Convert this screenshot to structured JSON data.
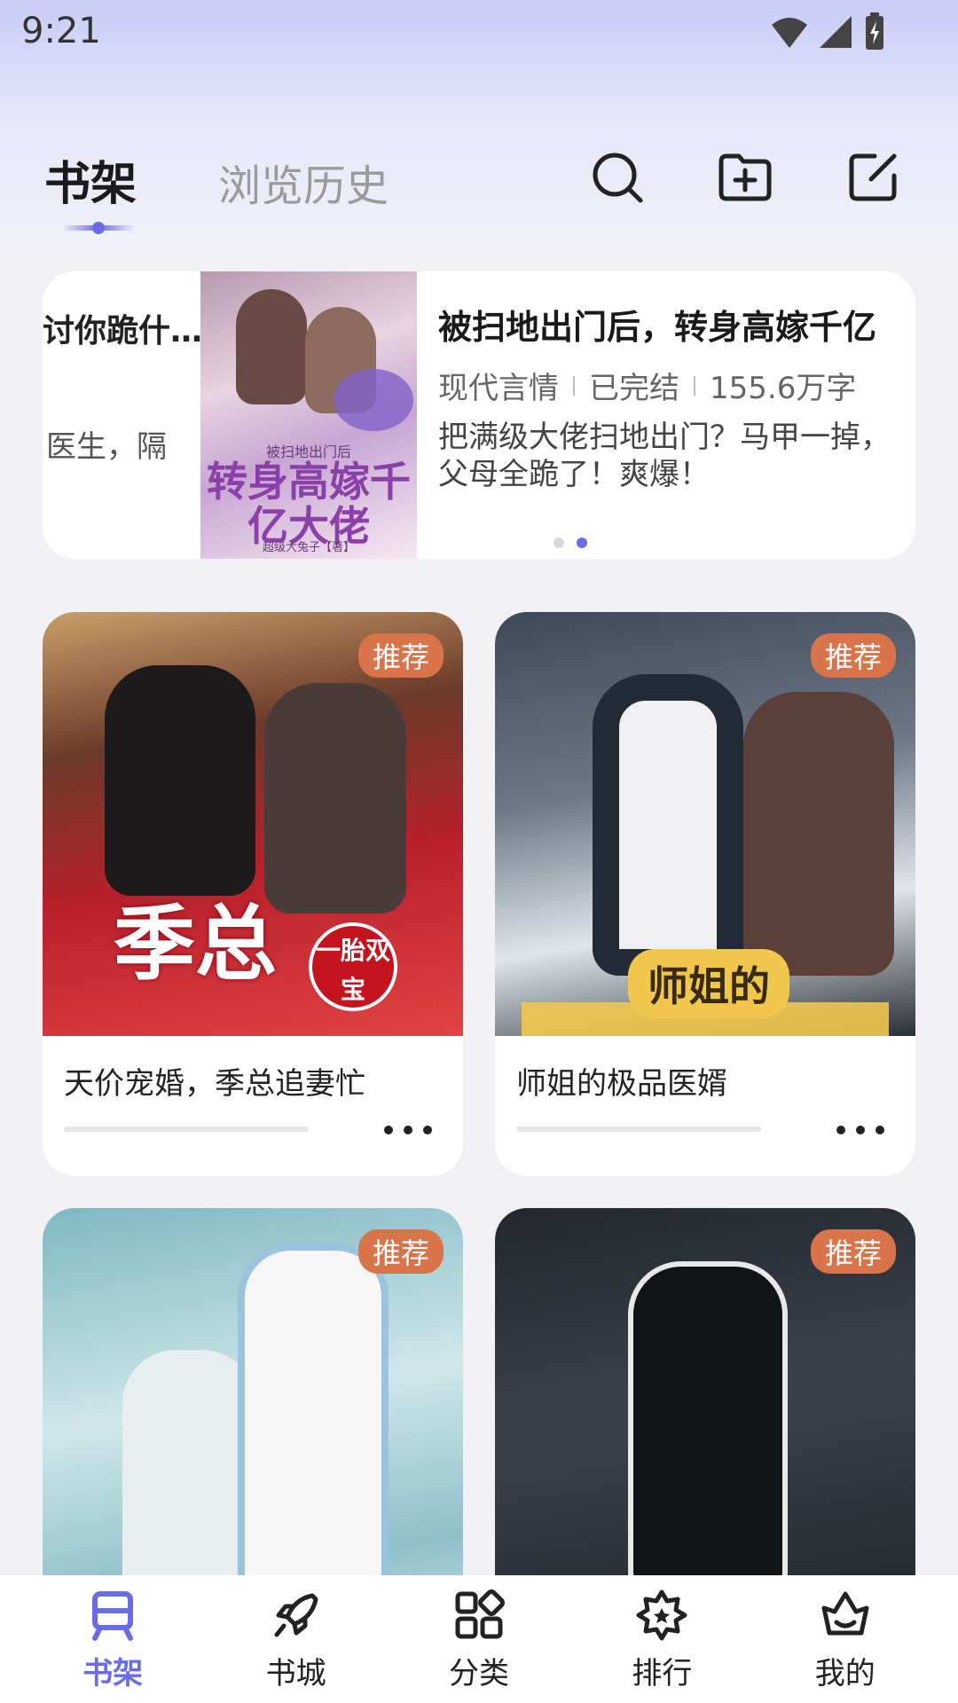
{
  "status_bar": {
    "time": "9:21"
  },
  "header": {
    "tabs": [
      {
        "label": "书架",
        "active": true
      },
      {
        "label": "浏览历史",
        "active": false
      }
    ],
    "icons": [
      "search-icon",
      "add-folder-icon",
      "edit-icon"
    ]
  },
  "banner": {
    "prev_title": "讨你跪什…",
    "prev_desc": "医生，隔",
    "cover": {
      "caption": "被扫地出门后",
      "big_text": "转身高嫁千亿大佬",
      "author": "超级大兔子【著】"
    },
    "title": "被扫地出门后，转身高嫁千亿",
    "meta": [
      "现代言情",
      "已完结",
      "155.6万字"
    ],
    "desc": "把满级大佬扫地出门？马甲一掉，父母全跪了！爽爆！",
    "page_count": 2,
    "active_page": 1
  },
  "books": [
    {
      "title": "天价宠婚，季总追妻忙",
      "badge": "推荐",
      "cover_text": "季总",
      "cover_stamp": "一胎双宝",
      "progress": 0
    },
    {
      "title": "师姐的极品医婿",
      "badge": "推荐",
      "cover_text": "师姐的",
      "progress": 0
    },
    {
      "title": "",
      "badge": "推荐"
    },
    {
      "title": "",
      "badge": "推荐"
    }
  ],
  "bottom_nav": [
    {
      "label": "书架",
      "icon": "bookshelf-icon",
      "active": true
    },
    {
      "label": "书城",
      "icon": "rocket-icon",
      "active": false
    },
    {
      "label": "分类",
      "icon": "category-icon",
      "active": false
    },
    {
      "label": "排行",
      "icon": "ranking-icon",
      "active": false
    },
    {
      "label": "我的",
      "icon": "profile-icon",
      "active": false
    }
  ],
  "colors": {
    "accent": "#6b6be6",
    "badge": "#d9734a"
  }
}
